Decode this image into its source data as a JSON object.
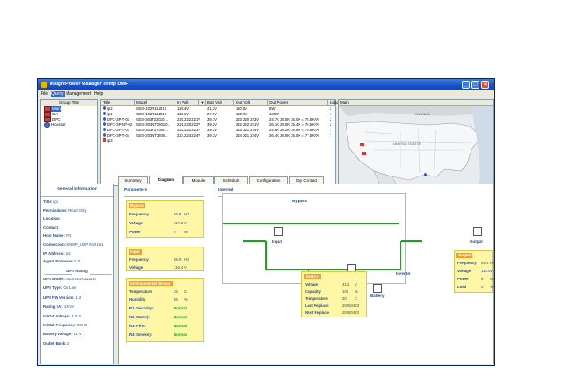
{
  "window": {
    "title": "InsightPower Manager snmp DMF",
    "minimize": "_",
    "maximize": "□",
    "close": "×"
  },
  "menu": [
    "File",
    "Query",
    "Management",
    "Help"
  ],
  "groups": {
    "header": "Group Title",
    "items": [
      {
        "label": "Main",
        "icon": "alarm-icon",
        "selected": true
      },
      {
        "label": "CA",
        "icon": "alarm-icon",
        "selected": false
      },
      {
        "label": "DPC",
        "icon": "alarm-icon",
        "selected": false
      },
      {
        "label": "Houston",
        "icon": "ups-icon",
        "selected": false
      }
    ]
  },
  "ups_table": {
    "columns": [
      "Title",
      "Model",
      "In Volt",
      "",
      "Batt Volt",
      "Out Volt",
      "Out Power",
      "Load"
    ],
    "rows": [
      {
        "icon": "ups",
        "title": "ip2",
        "model": "GES-102R11201I",
        "in_volt": "116.4V",
        "batt_volt": "41.2V",
        "out_volt": "110.0V",
        "out_power": "8W",
        "load": "2"
      },
      {
        "icon": "ups",
        "title": "ip1",
        "model": "GES-102R11201I",
        "in_volt": "115.1V",
        "batt_volt": "27.6V",
        "out_volt": "120.0V",
        "out_power": "108W",
        "load": "1"
      },
      {
        "icon": "ups",
        "title": "DPC-3P-T-01",
        "model": "GES-303T22010...",
        "in_volt": "220,222,221V",
        "batt_volt": "39.1V",
        "out_volt": "223 220 223V",
        "out_power": "24.7K 25.0K 26.0K = 75.6KVA",
        "load": "2"
      },
      {
        "icon": "ups",
        "title": "DPC-3P-NT-02",
        "model": "GES-303NT20010...",
        "in_volt": "221,220,222V",
        "batt_volt": "39.2V",
        "out_volt": "222 222 221V",
        "out_power": "26.1K 25.0K 25.4K = 76.5KVA",
        "load": "2"
      },
      {
        "icon": "ups",
        "title": "DPC-3P-T-03",
        "model": "GES-303T37008...",
        "in_volt": "222,221,223V",
        "batt_volt": "39.2V",
        "out_volt": "223 221 224V",
        "out_power": "25.6K 26.2K 26.8K = 78.6KVA",
        "load": "7"
      },
      {
        "icon": "ups",
        "title": "DPC-3P-T-04",
        "model": "GES-203NT3800...",
        "in_volt": "224,224,224V",
        "batt_volt": "39.2V",
        "out_volt": "224 221 224V",
        "out_power": "26.4K 26.0K 25.0K = 77.5KVA",
        "load": "7"
      },
      {
        "icon": "alarm",
        "title": "ip3",
        "model": "",
        "in_volt": "",
        "batt_volt": "",
        "out_volt": "",
        "out_power": "",
        "load": ""
      }
    ]
  },
  "map": {
    "header": "Main",
    "labels": [
      "CANADA",
      "UNITED STATES",
      "MEXICO"
    ]
  },
  "tabs": [
    "Summary",
    "Diagram",
    "Module",
    "Schedule",
    "Configuration",
    "Dry Contact"
  ],
  "general_info": {
    "title": "General Information",
    "rows": [
      {
        "k": "Title:",
        "v": "ip2"
      },
      {
        "k": "Permissions:",
        "v": "Read Only"
      },
      {
        "k": "Location:",
        "v": ""
      },
      {
        "k": "Contact:",
        "v": ""
      },
      {
        "k": "Host Name:",
        "v": "IP2"
      },
      {
        "k": "Connection:",
        "v": "SNMP_UDP Port 161"
      },
      {
        "k": "IP Address:",
        "v": "ip2"
      },
      {
        "k": "Agent Firmware:",
        "v": "2.0"
      }
    ],
    "ups_heading": "UPS Rating",
    "ups_rows": [
      {
        "k": "UPS Model:",
        "v": "GES-102R11201I"
      },
      {
        "k": "UPS Type:",
        "v": "On Line"
      },
      {
        "k": "UPS FW Version:",
        "v": "1.3"
      },
      {
        "k": "Rating VA:",
        "v": "1 KVA"
      },
      {
        "k": "In/Out Voltage:",
        "v": "110 V"
      },
      {
        "k": "In/Out Frequency:",
        "v": "60 Hz"
      },
      {
        "k": "Battery Voltage:",
        "v": "41 V"
      },
      {
        "k": "Outlet Bank:",
        "v": "2"
      }
    ]
  },
  "parameters": {
    "heading": "Parameters",
    "bypass": {
      "title": "Bypass",
      "rows": [
        {
          "k": "Frequency",
          "v": "59.9",
          "u": "Hz"
        },
        {
          "k": "Voltage",
          "v": "117.2",
          "u": "V"
        },
        {
          "k": "Power",
          "v": "0",
          "u": "W"
        }
      ]
    },
    "input": {
      "title": "Input",
      "rows": [
        {
          "k": "Frequency",
          "v": "59.9",
          "u": "Hz"
        },
        {
          "k": "Voltage",
          "v": "116.4",
          "u": "V"
        }
      ]
    },
    "env": {
      "title": "Environmental Sensor",
      "rows": [
        {
          "k": "Temperature",
          "v": "25",
          "u": "C"
        },
        {
          "k": "Humidity",
          "v": "55",
          "u": "%"
        }
      ],
      "status": [
        {
          "k": "R1 (Security):",
          "v": "Normal"
        },
        {
          "k": "R2 (Water):",
          "v": "Normal"
        },
        {
          "k": "R3 (Fire):",
          "v": "Normal"
        },
        {
          "k": "R4 (Smoke):",
          "v": "Normal"
        }
      ]
    }
  },
  "internal": {
    "heading": "Internal",
    "bypass": "Bypass",
    "input": "Input",
    "charger": "Charger",
    "inverter": "Inverter",
    "output": "Output",
    "battery": "Battery",
    "battery_card": {
      "title": "Battery",
      "rows": [
        {
          "k": "Voltage",
          "v": "41.2",
          "u": "V"
        },
        {
          "k": "Capacity",
          "v": "100",
          "u": "%"
        },
        {
          "k": "Temperature",
          "v": "30",
          "u": "C"
        },
        {
          "k": "Last Replace",
          "v": "20050423",
          "u": ""
        },
        {
          "k": "Next Replace",
          "v": "20080423",
          "u": ""
        }
      ]
    },
    "output_card": {
      "title": "Output",
      "rows": [
        {
          "k": "Frequency",
          "v": "59.9",
          "u": "Hz"
        },
        {
          "k": "Voltage",
          "v": "110.0",
          "u": "V"
        },
        {
          "k": "Power",
          "v": "8",
          "u": "W"
        },
        {
          "k": "Load",
          "v": "0",
          "u": "%"
        }
      ]
    }
  },
  "colors": {
    "flow": "#1ea31e",
    "card_bg": "#fff6a6",
    "card_title": "#f2a126",
    "accent": "#274c8c"
  }
}
